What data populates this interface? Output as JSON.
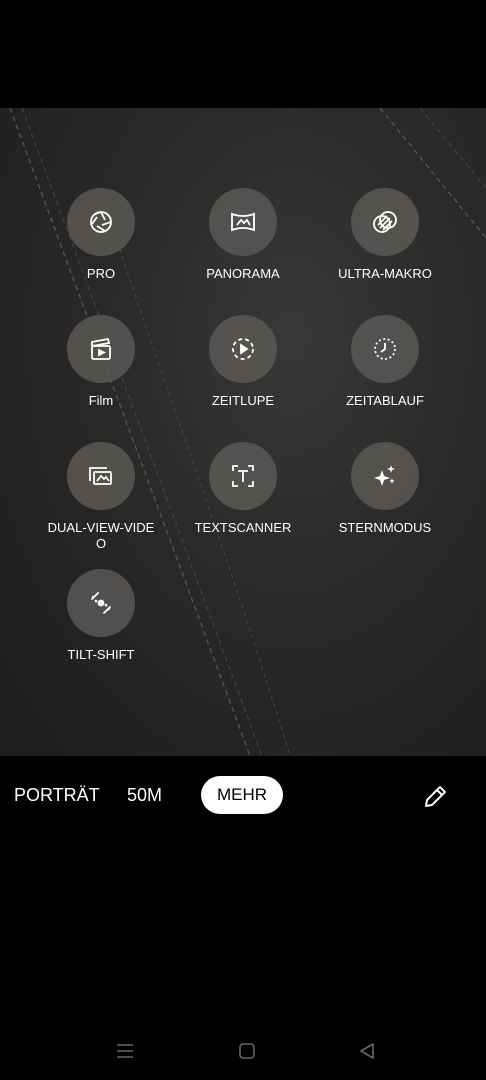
{
  "modes": [
    {
      "label": "PRO",
      "icon": "aperture-icon"
    },
    {
      "label": "PANORAMA",
      "icon": "panorama-icon"
    },
    {
      "label": "ULTRA-MAKRO",
      "icon": "macro-icon"
    },
    {
      "label": "Film",
      "icon": "clapperboard-icon"
    },
    {
      "label": "ZEITLUPE",
      "icon": "slow-motion-icon"
    },
    {
      "label": "ZEITABLAUF",
      "icon": "timelapse-icon"
    },
    {
      "label": "DUAL-VIEW-VIDEO",
      "icon": "dual-view-icon"
    },
    {
      "label": "TEXTSCANNER",
      "icon": "text-scanner-icon"
    },
    {
      "label": "STERNMODUS",
      "icon": "sparkle-icon"
    },
    {
      "label": "TILT-SHIFT",
      "icon": "tilt-shift-icon"
    }
  ],
  "tabs": {
    "portrait": "PORTRÄT",
    "fifty_m": "50M",
    "more": "MEHR"
  },
  "toolbar": {
    "edit_icon": "pencil-icon"
  },
  "navigation": {
    "recents_icon": "menu-icon",
    "home_icon": "square-icon",
    "back_icon": "back-triangle-icon"
  },
  "colors": {
    "background": "#000000",
    "button": "#5a5856",
    "active_tab_bg": "#ffffff"
  }
}
